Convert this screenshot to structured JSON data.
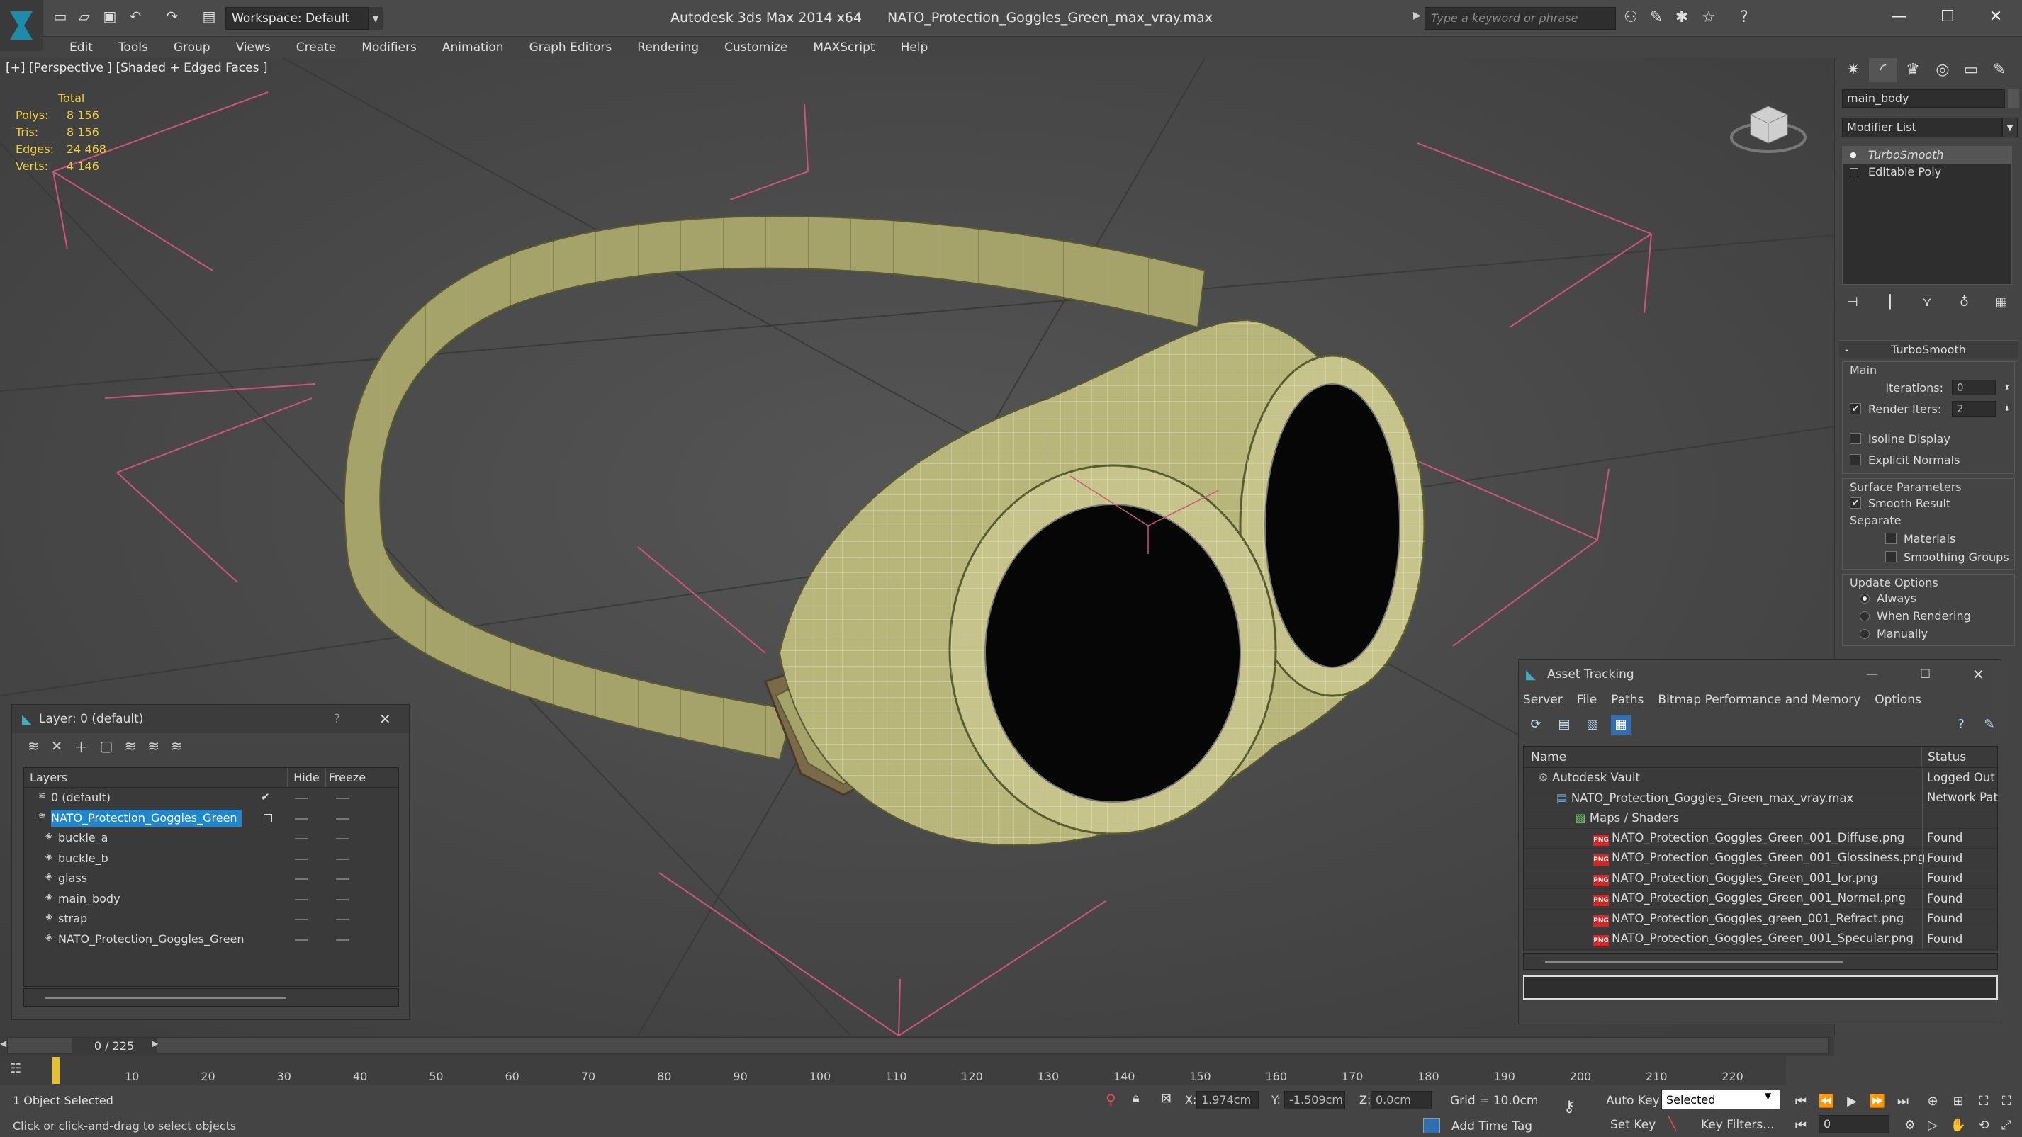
{
  "app": {
    "title": "Autodesk 3ds Max  2014 x64",
    "file": "NATO_Protection_Goggles_Green_max_vray.max",
    "workspace": "Workspace: Default",
    "search_placeholder": "Type a keyword or phrase"
  },
  "menu": [
    "Edit",
    "Tools",
    "Group",
    "Views",
    "Create",
    "Modifiers",
    "Animation",
    "Graph Editors",
    "Rendering",
    "Customize",
    "MAXScript",
    "Help"
  ],
  "viewport": {
    "label": "[+] [Perspective ] [Shaded + Edged Faces ]",
    "stats": {
      "header": "Total",
      "rows": [
        {
          "k": "Polys:",
          "v": "8 156"
        },
        {
          "k": "Tris:",
          "v": "8 156"
        },
        {
          "k": "Edges:",
          "v": "24 468"
        },
        {
          "k": "Verts:",
          "v": "4 146"
        }
      ]
    }
  },
  "command_panel": {
    "object_name": "main_body",
    "modifier_list": "Modifier List",
    "stack": [
      {
        "label": "TurboSmooth",
        "selected": true
      },
      {
        "label": "Editable Poly",
        "selected": false
      }
    ],
    "turbosmooth": {
      "title": "TurboSmooth",
      "main_label": "Main",
      "iterations_label": "Iterations:",
      "iterations_value": "0",
      "render_iters_label": "Render Iters:",
      "render_iters_value": "2",
      "isoline_label": "Isoline Display",
      "explicit_normals_label": "Explicit Normals",
      "surface_params_label": "Surface Parameters",
      "smooth_result_label": "Smooth Result",
      "separate_label": "Separate",
      "materials_label": "Materials",
      "smoothing_groups_label": "Smoothing Groups",
      "update_options_label": "Update Options",
      "always_label": "Always",
      "when_rendering_label": "When Rendering",
      "manually_label": "Manually"
    }
  },
  "layer_window": {
    "title": "Layer: 0 (default)",
    "help": "?",
    "columns": {
      "layers": "Layers",
      "hide": "Hide",
      "freeze": "Freeze"
    },
    "rows": [
      {
        "name": "0 (default)",
        "indent": 0,
        "selected": false
      },
      {
        "name": "NATO_Protection_Goggles_Green",
        "indent": 0,
        "selected": true
      },
      {
        "name": "buckle_a",
        "indent": 1,
        "selected": false
      },
      {
        "name": "buckle_b",
        "indent": 1,
        "selected": false
      },
      {
        "name": "glass",
        "indent": 1,
        "selected": false
      },
      {
        "name": "main_body",
        "indent": 1,
        "selected": false
      },
      {
        "name": "strap",
        "indent": 1,
        "selected": false
      },
      {
        "name": "NATO_Protection_Goggles_Green",
        "indent": 1,
        "selected": false
      }
    ]
  },
  "asset_window": {
    "title": "Asset Tracking",
    "menu": [
      "Server",
      "File",
      "Paths",
      "Bitmap Performance and Memory",
      "Options"
    ],
    "columns": {
      "name": "Name",
      "status": "Status"
    },
    "rows": [
      {
        "name": "Autodesk Vault",
        "status": "Logged Out",
        "indent": 0,
        "icon": "vault"
      },
      {
        "name": "NATO_Protection_Goggles_Green_max_vray.max",
        "status": "Network Pat",
        "indent": 1,
        "icon": "max"
      },
      {
        "name": "Maps / Shaders",
        "status": "",
        "indent": 2,
        "icon": "maps"
      },
      {
        "name": "NATO_Protection_Goggles_Green_001_Diffuse.png",
        "status": "Found",
        "indent": 3,
        "icon": "png"
      },
      {
        "name": "NATO_Protection_Goggles_Green_001_Glossiness.png",
        "status": "Found",
        "indent": 3,
        "icon": "png"
      },
      {
        "name": "NATO_Protection_Goggles_Green_001_Ior.png",
        "status": "Found",
        "indent": 3,
        "icon": "png"
      },
      {
        "name": "NATO_Protection_Goggles_Green_001_Normal.png",
        "status": "Found",
        "indent": 3,
        "icon": "png"
      },
      {
        "name": "NATO_Protection_Goggles_green_001_Refract.png",
        "status": "Found",
        "indent": 3,
        "icon": "png"
      },
      {
        "name": "NATO_Protection_Goggles_Green_001_Specular.png",
        "status": "Found",
        "indent": 3,
        "icon": "png"
      }
    ]
  },
  "timeline": {
    "frame_label": "0 / 225",
    "ticks": [
      "10",
      "20",
      "30",
      "40",
      "50",
      "60",
      "70",
      "80",
      "90",
      "100",
      "110",
      "120",
      "130",
      "140",
      "150",
      "160",
      "170",
      "180",
      "190",
      "200",
      "210",
      "220"
    ]
  },
  "status": {
    "selection": "1 Object Selected",
    "prompt": "Click or click-and-drag to select objects",
    "x_label": "X:",
    "x_value": "1.974cm",
    "y_label": "Y:",
    "y_value": "-1.509cm",
    "z_label": "Z:",
    "z_value": "0.0cm",
    "grid": "Grid = 10.0cm",
    "add_time_tag": "Add Time Tag",
    "auto_key": "Auto Key",
    "set_key": "Set Key",
    "selected_dropdown": "Selected",
    "key_filters": "Key Filters...",
    "frame_field": "0"
  },
  "colors": {
    "selection_blue": "#1f86d0",
    "stats_yellow": "#f0d23c",
    "model_green": "#b8b67a"
  }
}
